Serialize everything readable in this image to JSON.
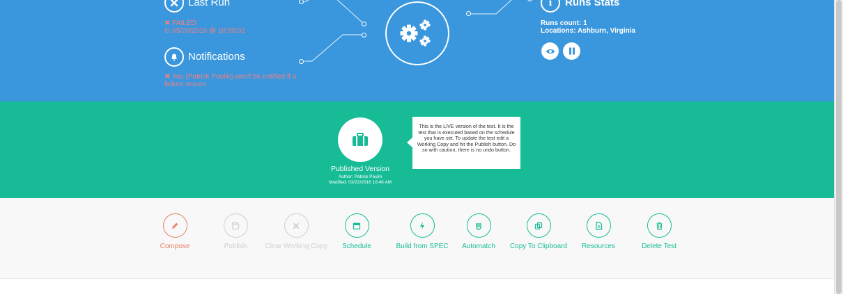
{
  "last_run": {
    "title": "Last Run",
    "status": "✖ FAILED",
    "timestamp": "⊙ 05/20/2016 @ 10:50:02"
  },
  "notifications": {
    "title": "Notifications",
    "message": "✖ You (Patrick Poulin) won't be notified if a failure occurs"
  },
  "runs_stats": {
    "title": "Runs Stats",
    "count": "Runs count: 1",
    "locations": "Locations: Ashburn, Virginia"
  },
  "published": {
    "title": "Published Version",
    "author": "Author: Patrick Poulin",
    "modified": "Modified: 03/22/2016 10:46 AM",
    "tooltip": "This is the LIVE version of the test. It is the test that is executed based on the schedule you have set. To update the test edit a Working Copy and hit the Publish button. Do so with caution, there is no undo button."
  },
  "actions": [
    {
      "label": "Compose",
      "icon": "pencil-icon",
      "color": "#e8806a"
    },
    {
      "label": "Publish",
      "icon": "save-icon",
      "color": "#cfcfcf"
    },
    {
      "label": "Clear Working Copy",
      "icon": "close-icon",
      "color": "#cfcfcf"
    },
    {
      "label": "Schedule",
      "icon": "calendar-icon",
      "color": "#17bc97"
    },
    {
      "label": "Build from SPEC",
      "icon": "bolt-icon",
      "color": "#17bc97"
    },
    {
      "label": "Automatch",
      "icon": "automatch-icon",
      "color": "#17bc97"
    },
    {
      "label": "Copy To Clipboard",
      "icon": "copy-icon",
      "color": "#17bc97"
    },
    {
      "label": "Resources",
      "icon": "document-icon",
      "color": "#17bc97"
    },
    {
      "label": "Delete Test",
      "icon": "trash-icon",
      "color": "#17bc97"
    }
  ],
  "colors": {
    "blue": "#3a97dd",
    "green": "#17bc97",
    "red": "#f08080"
  }
}
